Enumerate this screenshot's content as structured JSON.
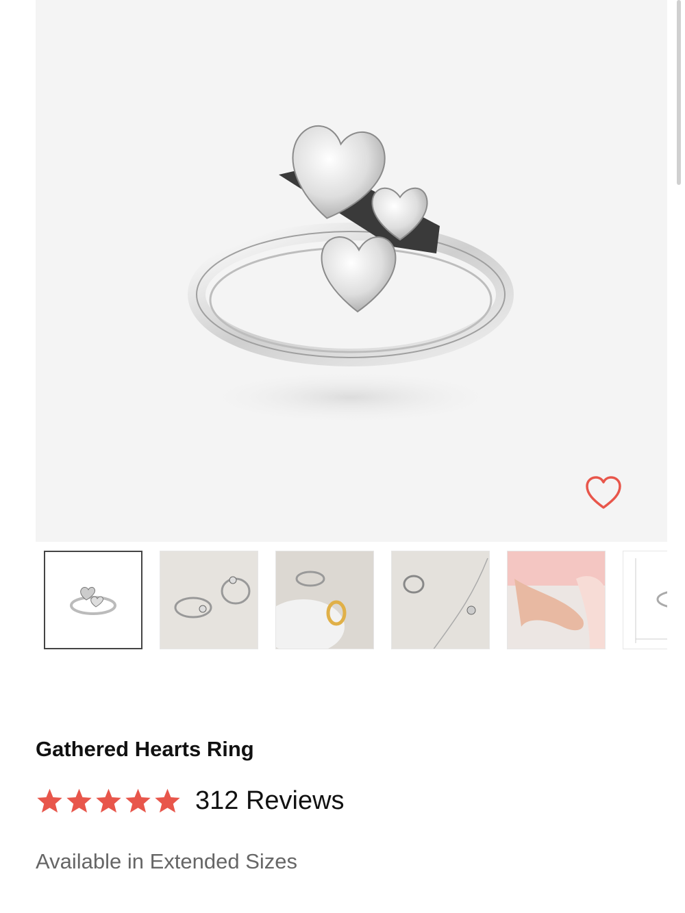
{
  "product": {
    "title": "Gathered Hearts Ring",
    "rating": 5,
    "rating_max": 5,
    "reviews_label": "312 Reviews",
    "availability": "Available in Extended Sizes"
  },
  "hero": {
    "wishlist_icon": "heart-outline-icon"
  },
  "thumbnails": [
    {
      "name": "ring-front-view",
      "active": true
    },
    {
      "name": "two-rings-pair",
      "active": false
    },
    {
      "name": "ring-silver-gold",
      "active": false
    },
    {
      "name": "ring-with-necklace",
      "active": false
    },
    {
      "name": "ring-on-hand",
      "active": false
    },
    {
      "name": "size-chart",
      "active": false
    }
  ],
  "colors": {
    "accent": "#e8564b",
    "text": "#111111",
    "muted": "#666666",
    "hero_bg": "#f4f4f4"
  }
}
